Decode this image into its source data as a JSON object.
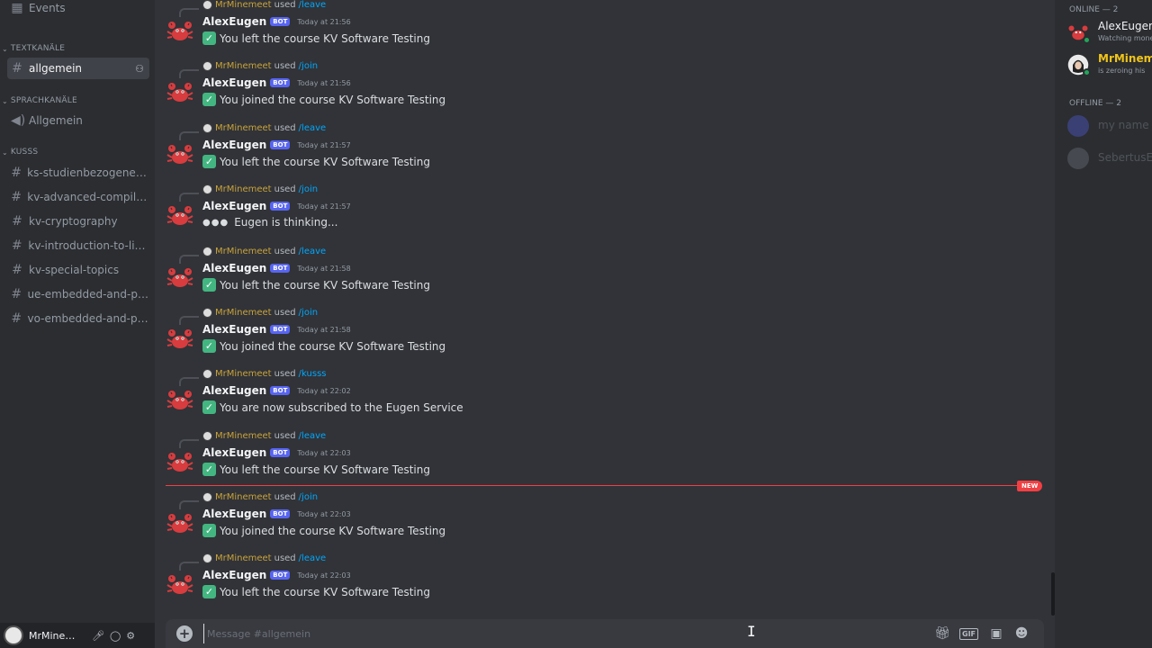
{
  "sidebar": {
    "events_label": "Events",
    "categories": {
      "text": "TEXTKANÄLE",
      "voice": "SPRACHKANÄLE",
      "kusss": "KUSSS"
    },
    "text_channels": [
      {
        "label": "allgemein"
      }
    ],
    "voice_channels": [
      {
        "label": "Allgemein"
      }
    ],
    "kusss_channels": [
      {
        "label": "ks-studienbezogene-pra..."
      },
      {
        "label": "kv-advanced-compiler-c..."
      },
      {
        "label": "kv-cryptography"
      },
      {
        "label": "kv-introduction-to-linux"
      },
      {
        "label": "kv-special-topics"
      },
      {
        "label": "ue-embedded-and-perv..."
      },
      {
        "label": "vo-embedded-and-perv..."
      }
    ],
    "user_panel": {
      "name": "MrMineme..."
    }
  },
  "chat": {
    "messages": [
      {
        "reply_user": "MrMinemeet",
        "used": "used",
        "command": "/leave",
        "author": "AlexEugen",
        "badge": "BOT",
        "time": "Today at 21:56",
        "text": "You left the course KV Software Testing",
        "kind": "check"
      },
      {
        "reply_user": "MrMinemeet",
        "used": "used",
        "command": "/join",
        "author": "AlexEugen",
        "badge": "BOT",
        "time": "Today at 21:56",
        "text": "You joined the course KV Software Testing",
        "kind": "check"
      },
      {
        "reply_user": "MrMinemeet",
        "used": "used",
        "command": "/leave",
        "author": "AlexEugen",
        "badge": "BOT",
        "time": "Today at 21:57",
        "text": "You left the course KV Software Testing",
        "kind": "check"
      },
      {
        "reply_user": "MrMinemeet",
        "used": "used",
        "command": "/join",
        "author": "AlexEugen",
        "badge": "BOT",
        "time": "Today at 21:57",
        "text": "Eugen is thinking...",
        "kind": "thinking"
      },
      {
        "reply_user": "MrMinemeet",
        "used": "used",
        "command": "/leave",
        "author": "AlexEugen",
        "badge": "BOT",
        "time": "Today at 21:58",
        "text": "You left the course KV Software Testing",
        "kind": "check"
      },
      {
        "reply_user": "MrMinemeet",
        "used": "used",
        "command": "/join",
        "author": "AlexEugen",
        "badge": "BOT",
        "time": "Today at 21:58",
        "text": "You joined the course KV Software Testing",
        "kind": "check"
      },
      {
        "reply_user": "MrMinemeet",
        "used": "used",
        "command": "/kusss",
        "author": "AlexEugen",
        "badge": "BOT",
        "time": "Today at 22:02",
        "text": "You are now subscribed to the Eugen Service",
        "kind": "check"
      },
      {
        "reply_user": "MrMinemeet",
        "used": "used",
        "command": "/leave",
        "author": "AlexEugen",
        "badge": "BOT",
        "time": "Today at 22:03",
        "text": "You left the course KV Software Testing",
        "kind": "check"
      },
      {
        "reply_user": "MrMinemeet",
        "used": "used",
        "command": "/join",
        "author": "AlexEugen",
        "badge": "BOT",
        "time": "Today at 22:03",
        "text": "You joined the course KV Software Testing",
        "kind": "check"
      },
      {
        "reply_user": "MrMinemeet",
        "used": "used",
        "command": "/leave",
        "author": "AlexEugen",
        "badge": "BOT",
        "time": "Today at 22:03",
        "text": "You left the course KV Software Testing",
        "kind": "check"
      }
    ],
    "new_badge": "NEW",
    "composer_placeholder": "Message #allgemein",
    "composer_icons": [
      "gift-icon",
      "gif-icon",
      "sticker-icon",
      "emoji-icon"
    ],
    "gif_label": "GIF"
  },
  "members": {
    "online_header": "ONLINE — 2",
    "offline_header": "OFFLINE — 2",
    "online": [
      {
        "name": "AlexEugen",
        "status": "Watching money",
        "color": "#f2f3f5"
      },
      {
        "name": "MrMinemeet",
        "status": "is zeroing his",
        "color": "#f0c419"
      }
    ],
    "offline": [
      {
        "name": "my name is"
      },
      {
        "name": "SebertusEu"
      }
    ]
  }
}
